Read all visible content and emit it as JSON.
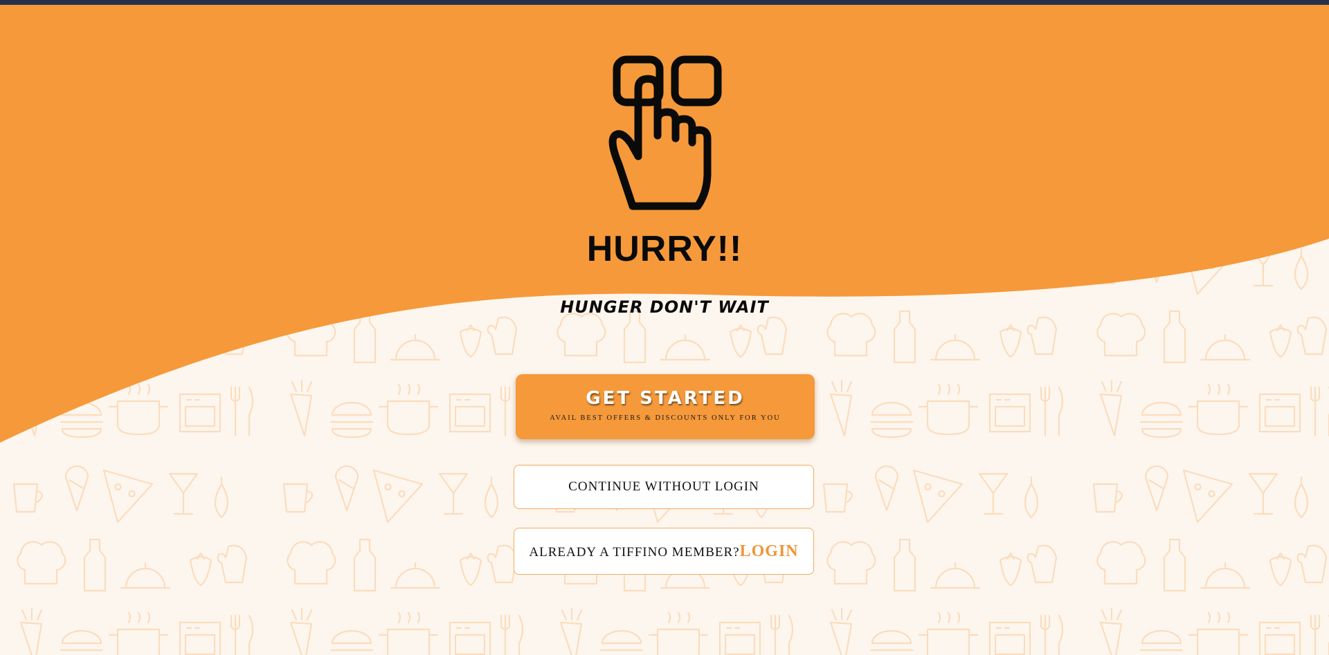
{
  "hero": {
    "icon": "tap-finger-icon",
    "headline": "HURRY!!",
    "tagline": "HUNGER DON'T WAIT"
  },
  "get_started": {
    "label": "GET STARTED",
    "sublabel": "AVAIL BEST OFFERS & DISCOUNTS ONLY FOR YOU"
  },
  "continue_button": {
    "label": "CONTINUE WITHOUT LOGIN"
  },
  "member_prompt": {
    "text": "ALREADY A TIFFINO MEMBER?",
    "login_label": "LOGIN"
  },
  "colors": {
    "accent": "#f6993a",
    "background": "#fdf6ee",
    "pattern": "#fbdcbd",
    "top_bar": "#27324a",
    "text": "#0a0a0a"
  }
}
